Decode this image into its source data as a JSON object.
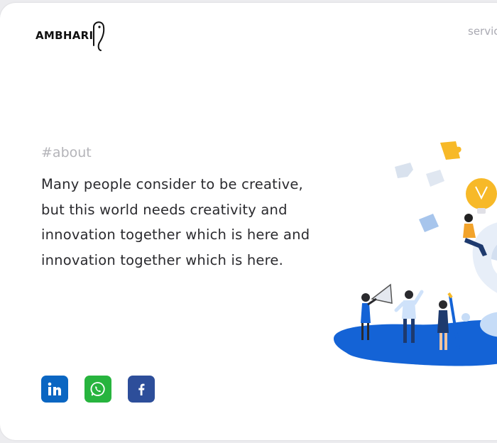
{
  "brand": {
    "name": "AMBHARI"
  },
  "nav": {
    "partial_link": "servic"
  },
  "about": {
    "hashtag": "#about",
    "body": "Many people consider to be creative, but this world needs creativity and innovation together which is here and innovation together which is here."
  },
  "social": [
    {
      "name": "linkedin",
      "icon": "linkedin-icon",
      "color": "#0a66c2"
    },
    {
      "name": "whatsapp",
      "icon": "whatsapp-icon",
      "color": "#27b43e"
    },
    {
      "name": "facebook",
      "icon": "facebook-icon",
      "color": "#2d4e9a"
    }
  ],
  "colors": {
    "accent_blue": "#1463d6",
    "bulb_yellow": "#f7b928",
    "text": "#2a2a2e",
    "muted": "#b4b4b9"
  }
}
